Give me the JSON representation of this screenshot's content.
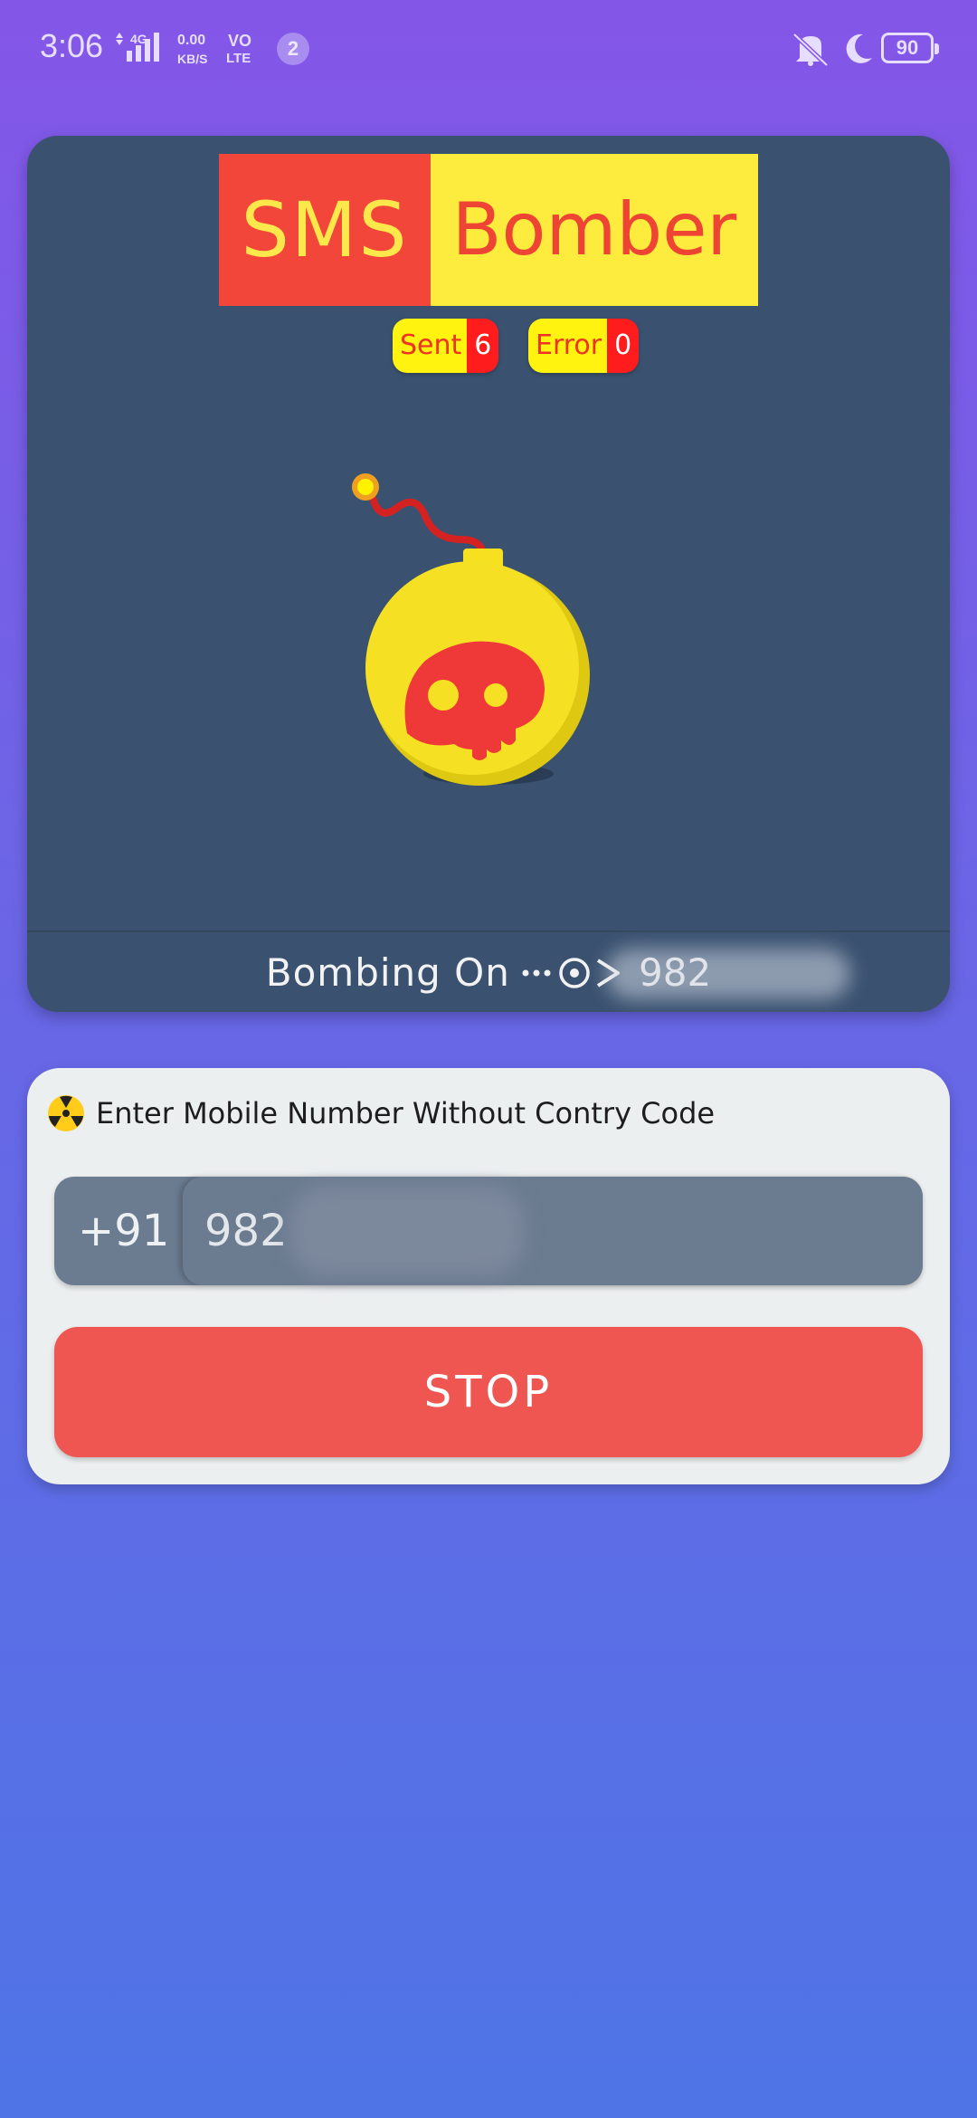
{
  "status_bar": {
    "time": "3:06",
    "network_type": "4G",
    "speed": "0.00",
    "speed_unit": "KB/S",
    "volte_top": "VO",
    "volte_bottom": "LTE",
    "notification_count": "2",
    "battery": "90",
    "icons": [
      "vibrate-off-icon",
      "moon-icon"
    ]
  },
  "header": {
    "logo_left": "SMS",
    "logo_right": "Bomber"
  },
  "stats": {
    "sent_label": "Sent",
    "sent_count": "6",
    "error_label": "Error",
    "error_count": "0"
  },
  "bombing": {
    "label": "Bombing On",
    "target_visible": "982"
  },
  "form": {
    "prompt": "Enter Mobile Number Without Contry Code",
    "country_code": "+91",
    "phone_value": "982",
    "stop_label": "STOP"
  },
  "colors": {
    "card_bg": "#3a5270",
    "logo_red": "#f3463a",
    "logo_yellow": "#fdeb3d",
    "stop_red": "#ef5652"
  }
}
